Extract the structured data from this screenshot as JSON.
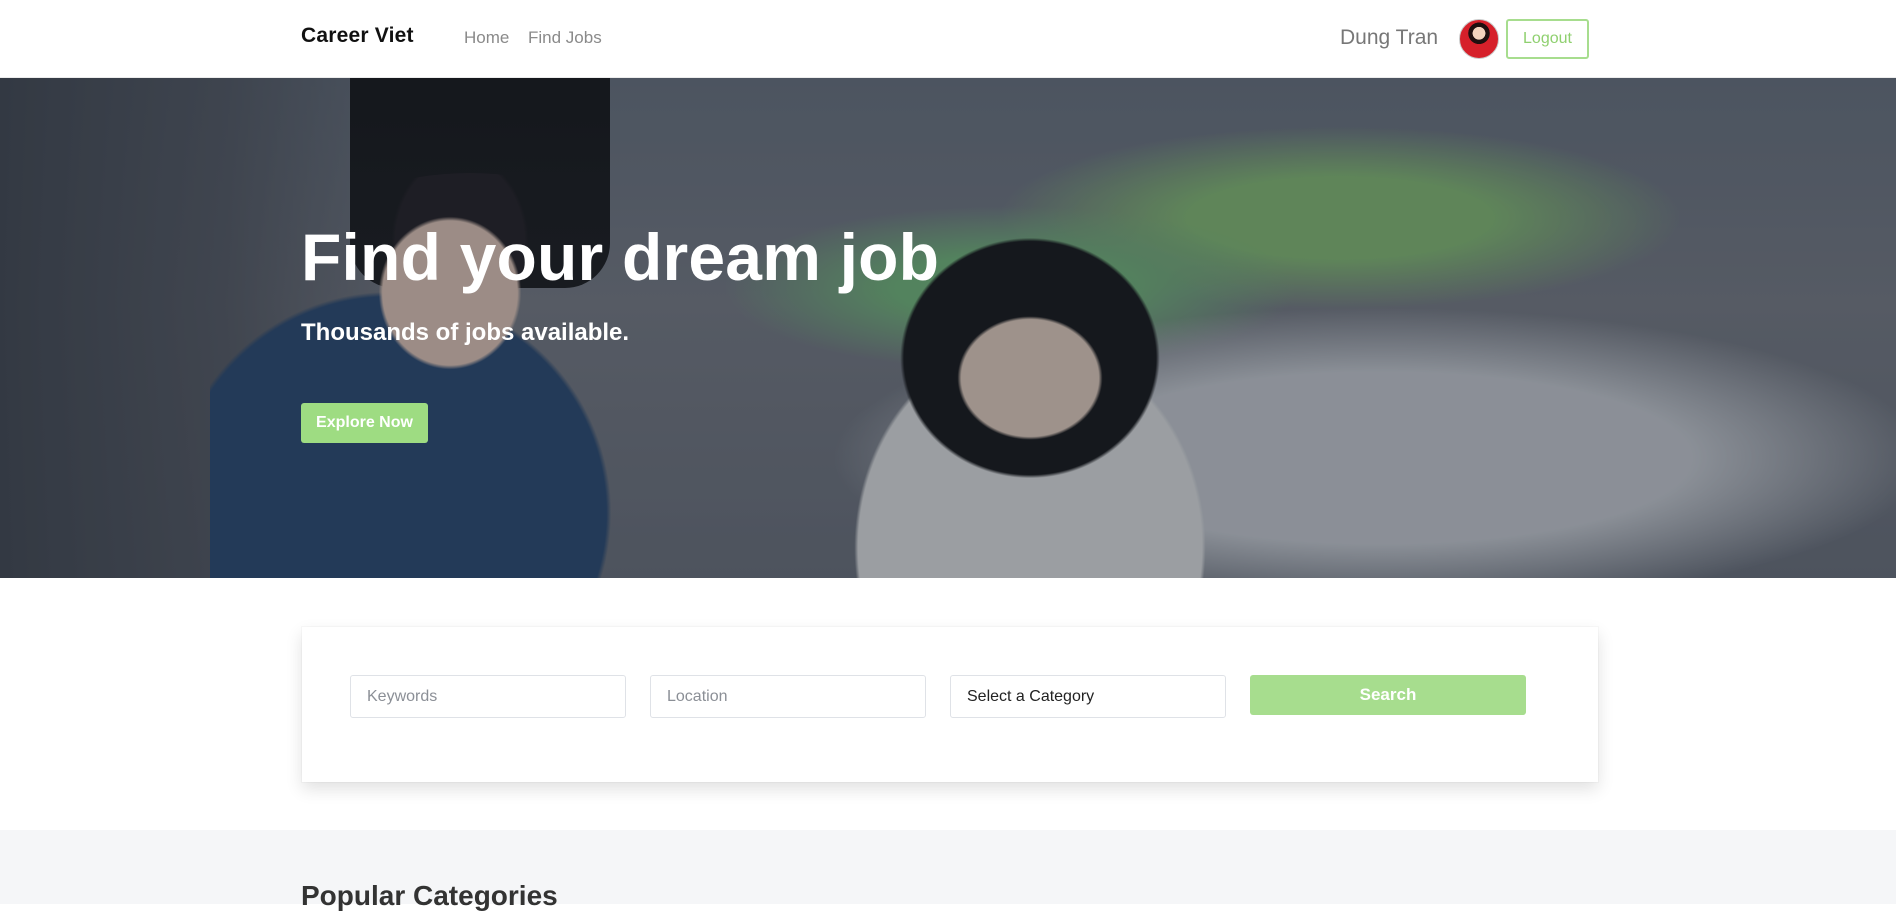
{
  "nav": {
    "brand": "Career Viet",
    "links": [
      "Home",
      "Find Jobs"
    ],
    "user_name": "Dung Tran",
    "logout_label": "Logout"
  },
  "hero": {
    "title": "Find your dream job",
    "subtitle": "Thousands of jobs available.",
    "cta_label": "Explore Now"
  },
  "search": {
    "keywords_placeholder": "Keywords",
    "location_placeholder": "Location",
    "category_value": "Select a Category",
    "search_label": "Search"
  },
  "categories": {
    "title": "Popular Categories"
  },
  "colors": {
    "accent": "#a7dd8e",
    "text_dark": "#111111",
    "nav_text": "#8a8a8a"
  }
}
